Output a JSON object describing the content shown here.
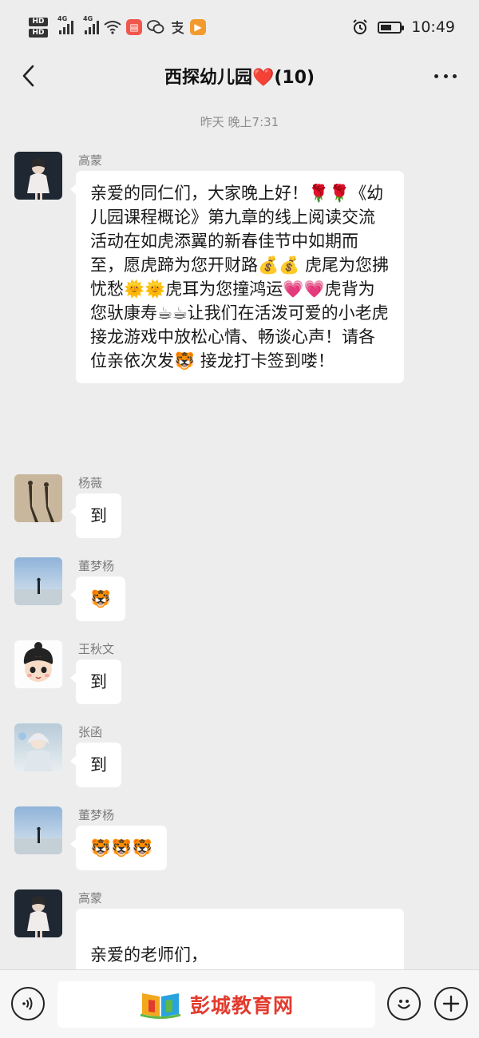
{
  "status": {
    "hd1": "HD",
    "hd2": "HD",
    "net1": "4G",
    "net2": "4G",
    "time": "10:49",
    "battery_level": 0.6,
    "apps": [
      "message-app",
      "wechat",
      "alipay",
      "video-app"
    ]
  },
  "chat": {
    "title": "西探幼儿园❤️(10)",
    "timestamp": "昨天 晚上7:31"
  },
  "messages": [
    {
      "sender": "高蒙",
      "text": "亲爱的同仁们，大家晚上好！🌹🌹《幼儿园课程概论》第九章的线上阅读交流活动在如虎添翼的新春佳节中如期而至，愿虎蹄为您开财路💰💰 虎尾为您拂忧愁🌞🌞虎耳为您撞鸿运💗💗虎背为您驮康寿☕☕让我们在活泼可爱的小老虎接龙游戏中放松心情、畅谈心声！请各位亲依次发🐯 接龙打卡签到喽！"
    },
    {
      "sender": "杨薇",
      "text": "到"
    },
    {
      "sender": "董梦杨",
      "text": "🐯"
    },
    {
      "sender": "王秋文",
      "text": "到"
    },
    {
      "sender": "张函",
      "text": "到"
    },
    {
      "sender": "董梦杨",
      "text": "🐯🐯🐯"
    },
    {
      "sender": "高蒙",
      "text": "亲爱的老师们，\n思想，一直跳动"
    }
  ],
  "watermark": {
    "text": "彭城教育网"
  },
  "colors": {
    "background": "#ededed",
    "bubble": "#ffffff",
    "watermark_red": "#e23b2e"
  },
  "icons": {
    "back": "chevron-left-icon",
    "more": "more-dots-icon",
    "voice": "voice-icon",
    "emoji": "emoji-icon",
    "plus": "plus-icon"
  }
}
